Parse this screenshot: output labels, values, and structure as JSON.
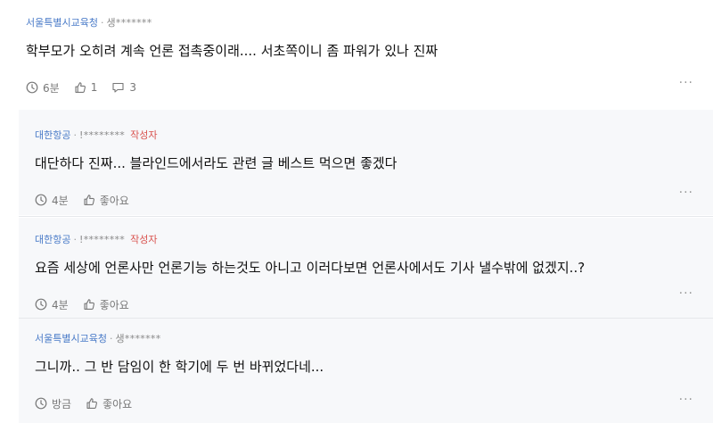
{
  "main_comment": {
    "org": "서울특별시교육청",
    "user": "생*******",
    "text": "학부모가 오히려 계속 언론 접촉중이래.... 서초쪽이니 좀 파워가 있나 진짜",
    "time": "6분",
    "likes": "1",
    "replies": "3",
    "more": "···"
  },
  "replies": [
    {
      "org": "대한항공",
      "user": "!********",
      "author_tag": "작성자",
      "text": "대단하다 진짜... 블라인드에서라도 관련 글 베스트 먹으면 좋겠다",
      "time": "4분",
      "like_label": "좋아요",
      "more": "···"
    },
    {
      "org": "대한항공",
      "user": "!********",
      "author_tag": "작성자",
      "text": "요즘 세상에 언론사만 언론기능 하는것도 아니고 이러다보면 언론사에서도 기사 낼수밖에 없겠지..?",
      "time": "4분",
      "like_label": "좋아요",
      "more": "···"
    },
    {
      "org": "서울특별시교육청",
      "user": "생*******",
      "text": "그니까.. 그 반 담임이 한 학기에 두 번 바뀌었다네...",
      "time": "방금",
      "like_label": "좋아요",
      "more": "···"
    }
  ],
  "colors": {
    "org": "#4a7bc8",
    "author_tag": "#d9534f",
    "reply_bg": "#f7f8fa"
  }
}
